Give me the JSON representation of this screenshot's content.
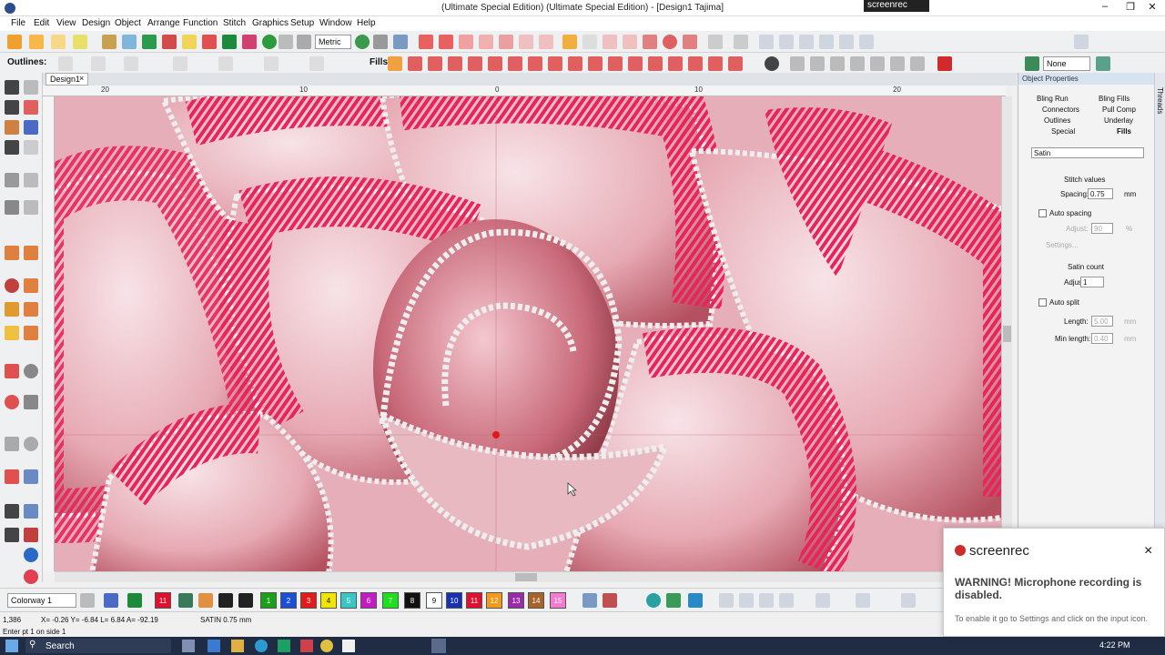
{
  "window": {
    "title": "(Ultimate Special Edition) (Ultimate Special Edition) - [Design1      Tajima]",
    "recorder_badge": "screenrec"
  },
  "menu": [
    "File",
    "Edit",
    "View",
    "Design",
    "Object",
    "Arrange",
    "Function",
    "Stitch",
    "Graphics",
    "Setup",
    "Window",
    "Help"
  ],
  "toolbar1": {
    "units_select": "Metric"
  },
  "toolbar2": {
    "outlines_label": "Outlines:",
    "fills_label": "Fills:",
    "none_select": "None"
  },
  "document": {
    "tab_label": "Design1",
    "close": "×"
  },
  "ruler": {
    "ticks": [
      "20",
      "10",
      "0",
      "10",
      "20"
    ]
  },
  "properties": {
    "header": "Object Properties",
    "tabs": [
      "Bling Run",
      "Bling Fills",
      "Connectors",
      "Pull Comp",
      "Outlines",
      "Underlay",
      "Special",
      "Fills"
    ],
    "fill_type": "Satin",
    "stitch_values_title": "Stitch values",
    "spacing_label": "Spacing:",
    "spacing_value": "0.75",
    "spacing_unit": "mm",
    "auto_spacing_label": "Auto spacing",
    "adjust_label": "Adjust:",
    "adjust_value_disabled": "90",
    "adjust_unit": "%",
    "settings_label": "Settings...",
    "satin_count_title": "Satin count",
    "satin_adjust_label": "Adjust:",
    "satin_adjust_value": "1",
    "auto_split_label": "Auto split",
    "length_label": "Length:",
    "length_value": "5.00",
    "min_length_label": "Min length:",
    "min_length_value": "0.40",
    "unit_mm": "mm",
    "side_tab": "Threads"
  },
  "colorway": {
    "select": "Colorway 1",
    "swatches": [
      {
        "n": "11",
        "color": "#e0102e"
      },
      {
        "n": "1",
        "color": "#1aa01a"
      },
      {
        "n": "2",
        "color": "#1c4fd8"
      },
      {
        "n": "3",
        "color": "#e21b1b"
      },
      {
        "n": "4",
        "color": "#f2e600"
      },
      {
        "n": "5",
        "color": "#3bc6c6"
      },
      {
        "n": "6",
        "color": "#c41bc4"
      },
      {
        "n": "7",
        "color": "#1ee01e"
      },
      {
        "n": "8",
        "color": "#111111"
      },
      {
        "n": "9",
        "color": "#ffffff"
      },
      {
        "n": "10",
        "color": "#1632b0"
      },
      {
        "n": "11",
        "color": "#e0102e"
      },
      {
        "n": "12",
        "color": "#f39a1c"
      },
      {
        "n": "13",
        "color": "#9a2aa8"
      },
      {
        "n": "14",
        "color": "#a6632a"
      },
      {
        "n": "15",
        "color": "#f47bd0"
      }
    ]
  },
  "status": {
    "count": "1,386",
    "coords": "X=  -0.26  Y=  -6.84  L=  6.84  A=  -92.19",
    "stitch": "SATIN  0.75 mm",
    "hint": "Enter pt 1 on side 1"
  },
  "taskbar": {
    "search": "Search",
    "time": "4:22 PM"
  },
  "toast": {
    "brand": "screenrec",
    "close": "×",
    "warning": "WARNING! Microphone recording is disabled.",
    "hint": "To enable it go to Settings and click on the input icon."
  },
  "colors": {
    "accent": "#e0205a",
    "thread": "#e8245c"
  }
}
